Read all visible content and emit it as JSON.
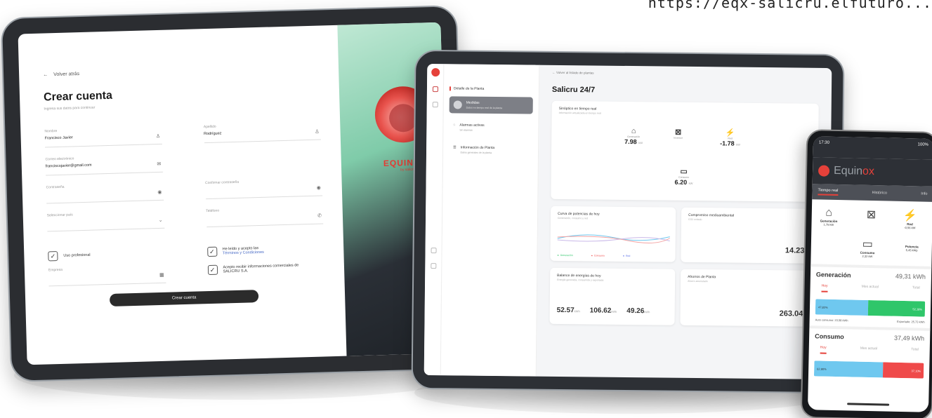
{
  "url_text": "https://eqx-salicru.elfuturo...",
  "signup": {
    "back_label": "Volver atrás",
    "title": "Crear cuenta",
    "subtitle": "Ingresa sus datos para continuar",
    "fields": [
      {
        "label": "Nombre",
        "value": "Francisco Javier"
      },
      {
        "label": "Apellido",
        "value": "Rodríguez"
      },
      {
        "label": "Correo electrónico",
        "value": "franciscojavier@gmail.com"
      },
      {
        "label": "Contraseña",
        "value": ""
      },
      {
        "label": "Confirmar contraseña",
        "value": ""
      },
      {
        "label": "Seleccionar país",
        "value": ""
      },
      {
        "label": "Teléfono",
        "value": ""
      }
    ],
    "pro_use": "Uso profesional",
    "company_label": "Empresa",
    "terms_text": "He leído y acepto las",
    "terms_link": "Términos y Condiciones",
    "marketing_text": "Acepto recibir informaciones comerciales de SALICRU S.A.",
    "submit": "Crear cuenta"
  },
  "brand": {
    "name": "EQUINOX",
    "sub": "by salicru"
  },
  "dashboard": {
    "breadcrumb": "Volver al listado de plantas",
    "menu_title": "Detalle de la Planta",
    "menu_items": [
      {
        "label": "Medidas",
        "sub": "Datos en tiempo real de la planta",
        "active": true
      },
      {
        "label": "Alarmas activas",
        "sub": "Sin alarmas",
        "active": false
      },
      {
        "label": "Información de Planta",
        "sub": "Datos generales de la planta",
        "active": false
      }
    ],
    "page_title": "Salicru 24/7",
    "synoptic": {
      "title": "Sinóptico en tiempo real",
      "sub": "Información actualizada en tiempo real",
      "generation": "7.98",
      "generation_label": "Generación",
      "grid": "-1.78",
      "grid_label": "Red",
      "consumption": "6.20",
      "consumption_label": "Consumo",
      "inverter_label": "Inversor",
      "unit": "kW"
    },
    "curve": {
      "title": "Curva de potencias de hoy",
      "sub": "Generación, consumo y red",
      "legend": [
        "Generación",
        "Consumo",
        "Red"
      ]
    },
    "env": {
      "title": "Compromiso medioambiental",
      "sub": "CO2 evitado",
      "value": "14.23",
      "unit": "t"
    },
    "balance": {
      "title": "Balance de energías de hoy",
      "sub": "Energía generada, consumida y exportada",
      "values": [
        "52.57",
        "106.62",
        "49.26"
      ],
      "unit": "kWh"
    },
    "savings": {
      "title": "Ahorros de Planta",
      "sub": "Ahorro acumulado",
      "value": "263.04",
      "unit": "€"
    }
  },
  "phone": {
    "time": "17:30",
    "status_right": "100%",
    "app_name_pre": "Equin",
    "app_name_hl": "ox",
    "tabs": [
      "Tiempo real",
      "Histórico",
      "Info"
    ],
    "flow": {
      "gen_label": "Generación",
      "gen_val": "1,75 kW",
      "grid_label": "Red",
      "grid_val": "-0,56 kW",
      "cons_label": "Consumo",
      "cons_val": "2,32 kW",
      "pow_label": "Potencia",
      "pow_val": "5,45 kWp"
    },
    "gen": {
      "title": "Generación",
      "total": "49,31 kWh",
      "tabs": [
        "Hoy",
        "Mes actual",
        "Total"
      ],
      "left_pct": "47,82%",
      "right_pct": "52,18%",
      "left_frac": 0.4782,
      "self": "Auto consumo: 23,58 kWh",
      "export": "Exportado: 25,73 kWh"
    },
    "cons": {
      "title": "Consumo",
      "total": "37,49 kWh",
      "tabs": [
        "Hoy",
        "Mes actual",
        "Total"
      ],
      "left_pct": "62,90%",
      "right_pct": "37,10%",
      "left_frac": 0.629
    }
  },
  "colors": {
    "accent": "#e5413a",
    "blue": "#6fc8ef",
    "green": "#2fc66a",
    "red": "#ef4a4a"
  }
}
